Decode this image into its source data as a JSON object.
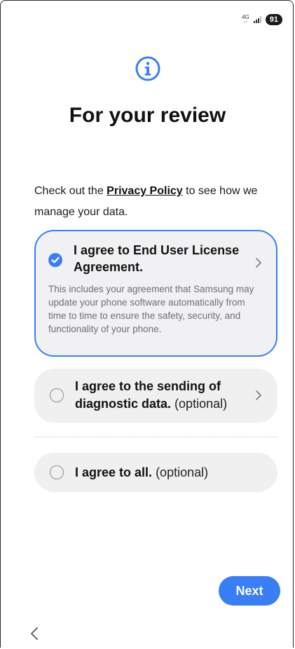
{
  "status_bar": {
    "network": "4G",
    "battery": "91"
  },
  "header": {
    "icon": "info-icon",
    "title": "For your review"
  },
  "intro": {
    "before": "Check out the ",
    "link": "Privacy Policy",
    "after": " to see how we manage your data."
  },
  "agreements": {
    "eula": {
      "label": "I agree to End User License Agreement.",
      "checked": true,
      "description": "This includes your agreement that Samsung may update your phone software automatically from time to time to ensure the safety, security, and functionality of your phone."
    },
    "diagnostic": {
      "label": "I agree to the sending of diagnostic data.",
      "suffix": "(optional)",
      "checked": false
    },
    "all": {
      "label": "I agree to all.",
      "suffix": "(optional)",
      "checked": false
    }
  },
  "footer": {
    "next_label": "Next",
    "back_icon": "chevron-left-icon"
  },
  "colors": {
    "accent": "#3a7ef5",
    "card_bg": "#f0f0f1",
    "desc_text": "#6f6f73"
  }
}
